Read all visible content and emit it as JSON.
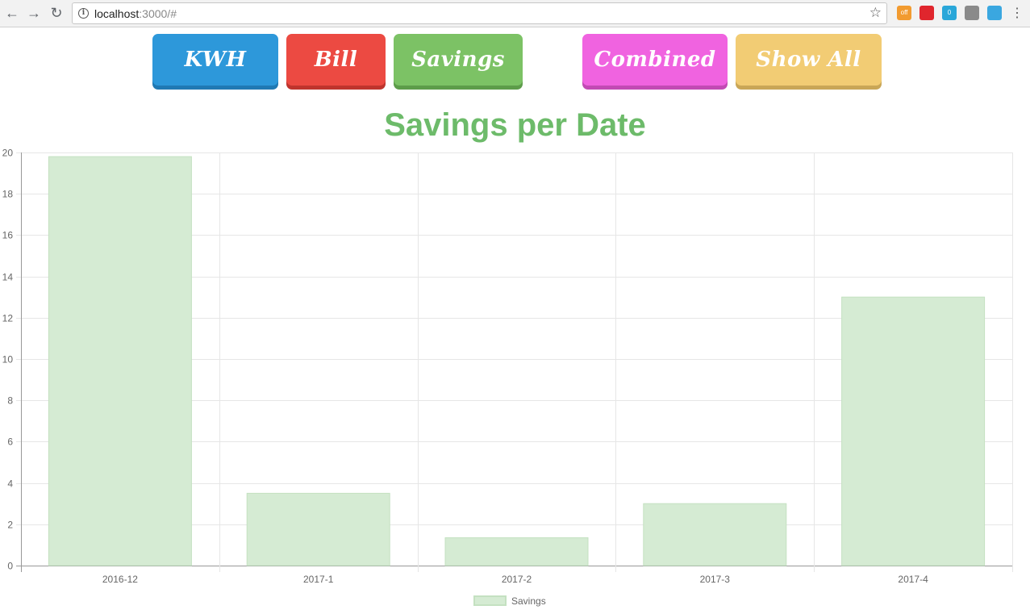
{
  "browser": {
    "url_host": "localhost",
    "url_path": ":3000/#",
    "extensions": [
      {
        "name": "off-extension-icon",
        "badge": "off",
        "color": "#f29b30"
      },
      {
        "name": "opera-extension-icon",
        "badge": "",
        "color": "#e0262d"
      },
      {
        "name": "ghostery-extension-icon",
        "badge": "0",
        "color": "#2aa7d9"
      },
      {
        "name": "recycle-extension-icon",
        "badge": "",
        "color": "#8a8a8a"
      },
      {
        "name": "dropper-extension-icon",
        "badge": "",
        "color": "#3aa7e0"
      }
    ]
  },
  "buttons": [
    {
      "label": "KWH",
      "name": "kwh-button"
    },
    {
      "label": "Bill",
      "name": "bill-button"
    },
    {
      "label": "Savings",
      "name": "savings-button"
    },
    {
      "label": "Combined",
      "name": "combined-button"
    },
    {
      "label": "Show All",
      "name": "show-all-button"
    }
  ],
  "colors": {
    "title": "#6dbb6a",
    "bar_fill": "#d5ebd3",
    "bar_border": "#c4e1c1",
    "grid": "#e6e6e6",
    "axis": "#999999"
  },
  "chart_data": {
    "type": "bar",
    "title": "Savings per Date",
    "categories": [
      "2016-12",
      "2017-1",
      "2017-2",
      "2017-3",
      "2017-4"
    ],
    "series": [
      {
        "name": "Savings",
        "values": [
          19.8,
          3.5,
          1.35,
          3.0,
          13.0
        ]
      }
    ],
    "ylim": [
      0,
      20
    ],
    "yticks": [
      0,
      2,
      4,
      6,
      8,
      10,
      12,
      14,
      16,
      18,
      20
    ],
    "grid": true,
    "legend": "bottom-center"
  }
}
